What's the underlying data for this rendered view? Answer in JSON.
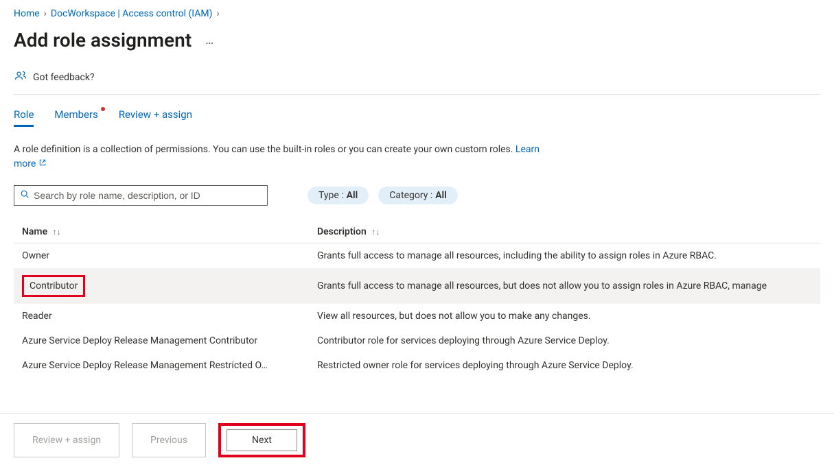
{
  "breadcrumb": {
    "home": "Home",
    "workspace": "DocWorkspace | Access control (IAM)"
  },
  "page": {
    "title": "Add role assignment"
  },
  "feedback": {
    "label": "Got feedback?"
  },
  "tabs": {
    "role": "Role",
    "members": "Members",
    "review": "Review + assign"
  },
  "description": {
    "text": "A role definition is a collection of permissions. You can use the built-in roles or you can create your own custom roles. ",
    "learn_more": "Learn more"
  },
  "search": {
    "placeholder": "Search by role name, description, or ID"
  },
  "filters": {
    "type_label": "Type : ",
    "type_value": "All",
    "category_label": "Category : ",
    "category_value": "All"
  },
  "table": {
    "headers": {
      "name": "Name",
      "description": "Description"
    },
    "rows": [
      {
        "name": "Owner",
        "description": "Grants full access to manage all resources, including the ability to assign roles in Azure RBAC.",
        "selected": false,
        "highlight": false
      },
      {
        "name": "Contributor",
        "description": "Grants full access to manage all resources, but does not allow you to assign roles in Azure RBAC, manage",
        "selected": true,
        "highlight": true
      },
      {
        "name": "Reader",
        "description": "View all resources, but does not allow you to make any changes.",
        "selected": false,
        "highlight": false
      },
      {
        "name": "Azure Service Deploy Release Management Contributor",
        "description": "Contributor role for services deploying through Azure Service Deploy.",
        "selected": false,
        "highlight": false
      },
      {
        "name": "Azure Service Deploy Release Management Restricted O…",
        "description": "Restricted owner role for services deploying through Azure Service Deploy.",
        "selected": false,
        "highlight": false
      }
    ]
  },
  "footer": {
    "review": "Review + assign",
    "previous": "Previous",
    "next": "Next"
  }
}
